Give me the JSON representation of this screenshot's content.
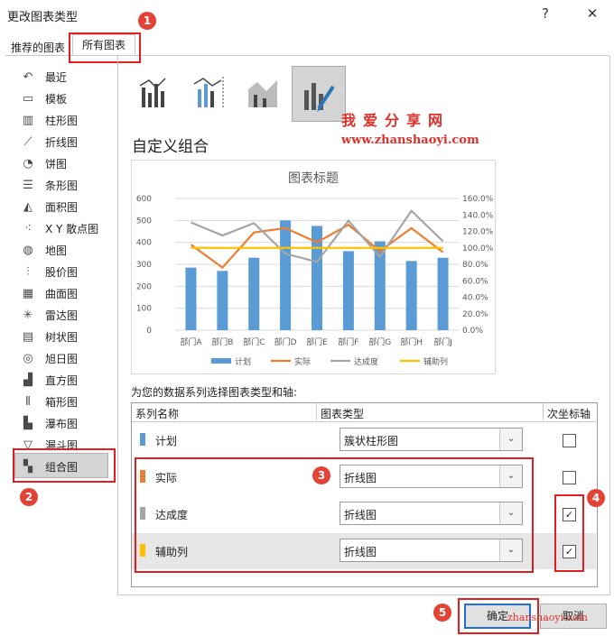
{
  "window": {
    "title": "更改图表类型",
    "help": "?",
    "close": "✕"
  },
  "tabs": {
    "recommended": "推荐的图表",
    "all": "所有图表"
  },
  "sidebar": {
    "items": [
      {
        "label": "最近",
        "icon": "recent-icon"
      },
      {
        "label": "模板",
        "icon": "template-icon"
      },
      {
        "label": "柱形图",
        "icon": "column-chart-icon"
      },
      {
        "label": "折线图",
        "icon": "line-chart-icon"
      },
      {
        "label": "饼图",
        "icon": "pie-chart-icon"
      },
      {
        "label": "条形图",
        "icon": "bar-chart-icon"
      },
      {
        "label": "面积图",
        "icon": "area-chart-icon"
      },
      {
        "label": "X Y 散点图",
        "icon": "scatter-chart-icon"
      },
      {
        "label": "地图",
        "icon": "map-chart-icon"
      },
      {
        "label": "股价图",
        "icon": "stock-chart-icon"
      },
      {
        "label": "曲面图",
        "icon": "surface-chart-icon"
      },
      {
        "label": "雷达图",
        "icon": "radar-chart-icon"
      },
      {
        "label": "树状图",
        "icon": "treemap-chart-icon"
      },
      {
        "label": "旭日图",
        "icon": "sunburst-chart-icon"
      },
      {
        "label": "直方图",
        "icon": "histogram-chart-icon"
      },
      {
        "label": "箱形图",
        "icon": "box-chart-icon"
      },
      {
        "label": "瀑布图",
        "icon": "waterfall-chart-icon"
      },
      {
        "label": "漏斗图",
        "icon": "funnel-chart-icon"
      },
      {
        "label": "组合图",
        "icon": "combo-chart-icon",
        "selected": true
      }
    ]
  },
  "section_title": "自定义组合",
  "watermark": {
    "text1": "我爱分享网",
    "text2": "www.zhanshaoyi.com",
    "text3": "zhanshaoyi.com"
  },
  "badges": [
    "1",
    "2",
    "3",
    "4",
    "5"
  ],
  "chart_data": {
    "type": "combo",
    "title": "图表标题",
    "categories": [
      "部门A",
      "部门B",
      "部门C",
      "部门D",
      "部门E",
      "部门F",
      "部门G",
      "部门H",
      "部门J"
    ],
    "y_left": {
      "ticks": [
        "0",
        "100",
        "200",
        "300",
        "400",
        "500",
        "600"
      ],
      "ylim": [
        0,
        600
      ]
    },
    "y_right": {
      "ticks": [
        "0.0%",
        "20.0%",
        "40.0%",
        "60.0%",
        "80.0%",
        "100.0%",
        "120.0%",
        "140.0%",
        "160.0%"
      ],
      "ylim": [
        0,
        160
      ]
    },
    "series": [
      {
        "name": "计划",
        "kind": "bar",
        "axis": "left",
        "color": "#5b9bd5",
        "values": [
          285,
          270,
          330,
          500,
          475,
          360,
          405,
          315,
          330
        ]
      },
      {
        "name": "实际",
        "kind": "line",
        "axis": "left",
        "color": "#ed7d31",
        "values": [
          390,
          285,
          445,
          465,
          400,
          480,
          360,
          465,
          355
        ]
      },
      {
        "name": "达成度",
        "kind": "line",
        "axis": "right",
        "color": "#a5a5a5",
        "values": [
          131,
          115,
          130,
          93,
          83,
          133,
          89,
          145,
          108
        ]
      },
      {
        "name": "辅助列",
        "kind": "line",
        "axis": "right",
        "color": "#ffc000",
        "values": [
          100,
          100,
          100,
          100,
          100,
          100,
          100,
          100,
          100
        ]
      }
    ],
    "legend": "bottom",
    "grid": true
  },
  "series_prompt": "为您的数据系列选择图表类型和轴:",
  "grid": {
    "headers": {
      "name": "系列名称",
      "type": "图表类型",
      "secondary": "次坐标轴"
    },
    "rows": [
      {
        "name": "计划",
        "color": "#5b9bd5",
        "type": "簇状柱形图",
        "secondary": false,
        "checkmark": ""
      },
      {
        "name": "实际",
        "color": "#ed7d31",
        "type": "折线图",
        "secondary": false,
        "checkmark": ""
      },
      {
        "name": "达成度",
        "color": "#a5a5a5",
        "type": "折线图",
        "secondary": true,
        "checkmark": "✓"
      },
      {
        "name": "辅助列",
        "color": "#ffc000",
        "type": "折线图",
        "secondary": true,
        "checkmark": "✓"
      }
    ]
  },
  "buttons": {
    "ok": "确定",
    "cancel": "取消"
  }
}
